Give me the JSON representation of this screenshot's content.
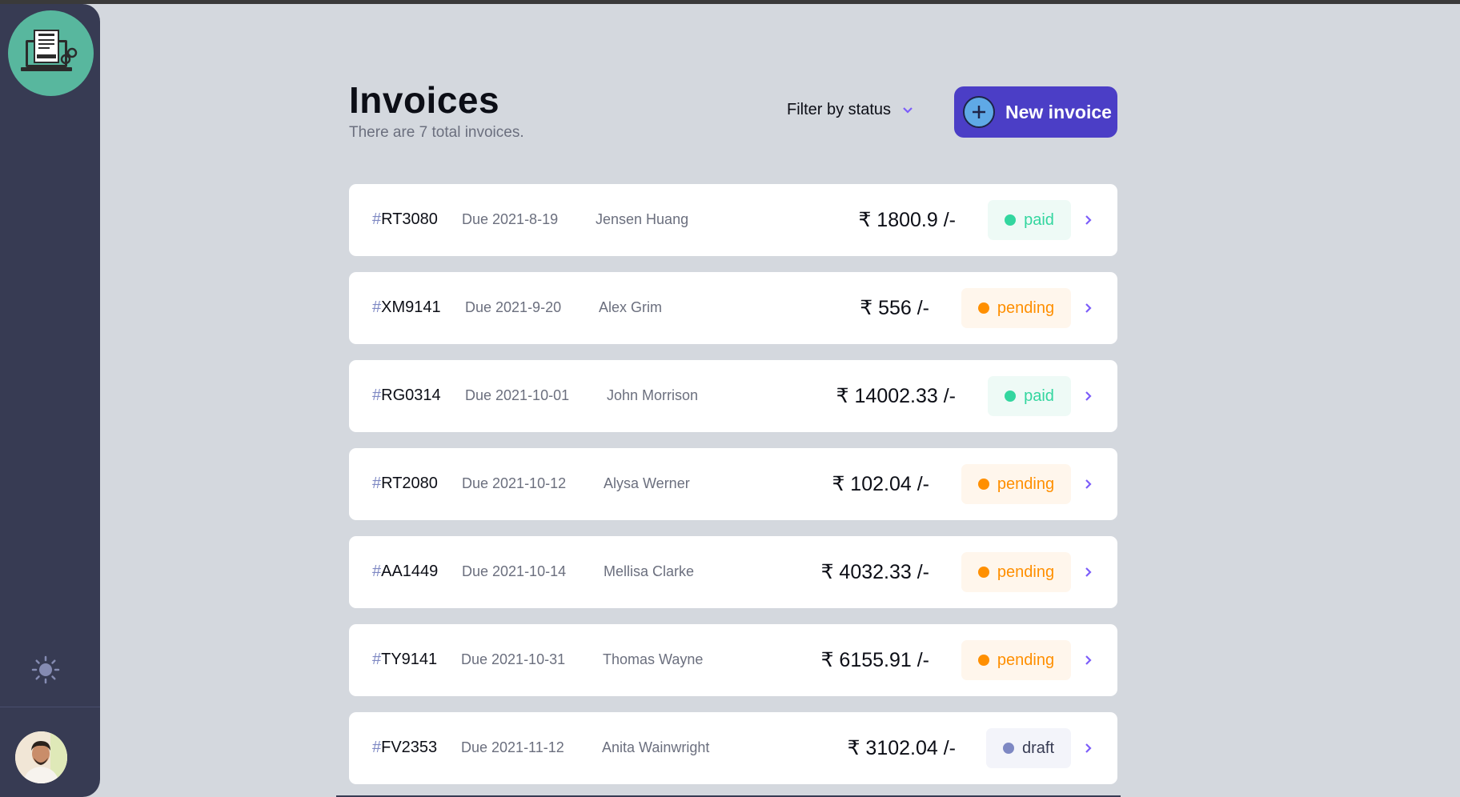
{
  "header": {
    "title": "Invoices",
    "subtitle": "There are 7 total invoices.",
    "filter_label": "Filter by status",
    "new_invoice_label": "New invoice"
  },
  "sidebar": {
    "logo_icon": "invoice-laptop-icon",
    "theme_icon": "sun-icon",
    "avatar": "user-avatar"
  },
  "colors": {
    "accent": "#4b3ec6",
    "paid": "#33d69f",
    "pending": "#ff8f00",
    "draft": "#7e88c3"
  },
  "invoices": [
    {
      "hash": "#",
      "id": "RT3080",
      "due": "Due 2021-8-19",
      "client": "Jensen Huang",
      "amount": "₹ 1800.9 /-",
      "status": "paid"
    },
    {
      "hash": "#",
      "id": "XM9141",
      "due": "Due 2021-9-20",
      "client": "Alex Grim",
      "amount": "₹ 556 /-",
      "status": "pending"
    },
    {
      "hash": "#",
      "id": "RG0314",
      "due": "Due 2021-10-01",
      "client": "John Morrison",
      "amount": "₹ 14002.33 /-",
      "status": "paid"
    },
    {
      "hash": "#",
      "id": "RT2080",
      "due": "Due 2021-10-12",
      "client": "Alysa Werner",
      "amount": "₹ 102.04 /-",
      "status": "pending"
    },
    {
      "hash": "#",
      "id": "AA1449",
      "due": "Due 2021-10-14",
      "client": "Mellisa Clarke",
      "amount": "₹ 4032.33 /-",
      "status": "pending"
    },
    {
      "hash": "#",
      "id": "TY9141",
      "due": "Due 2021-10-31",
      "client": "Thomas Wayne",
      "amount": "₹ 6155.91 /-",
      "status": "pending"
    },
    {
      "hash": "#",
      "id": "FV2353",
      "due": "Due 2021-11-12",
      "client": "Anita Wainwright",
      "amount": "₹ 3102.04 /-",
      "status": "draft"
    }
  ]
}
